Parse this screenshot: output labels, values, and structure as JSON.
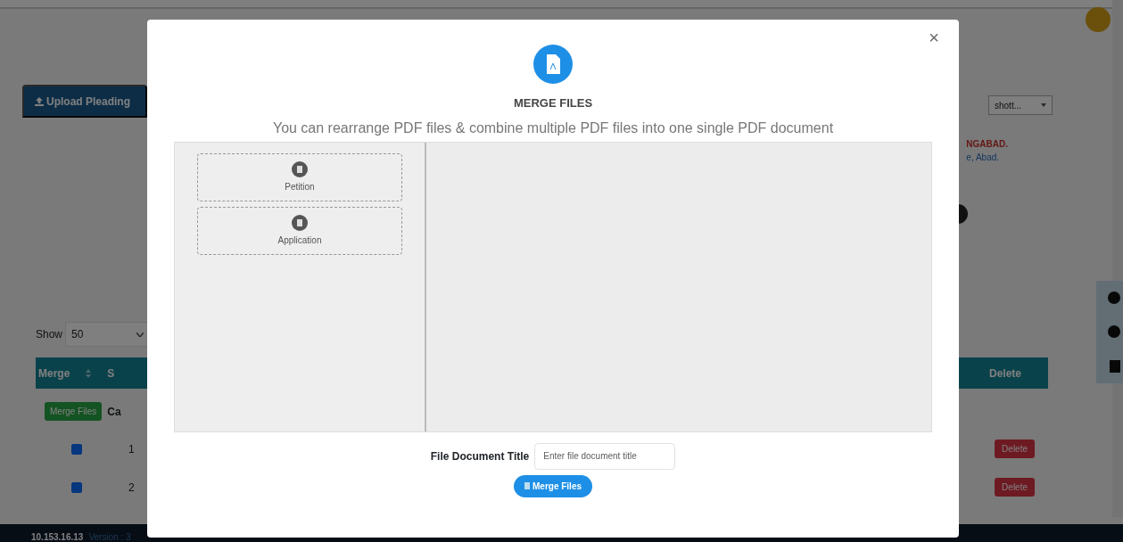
{
  "background": {
    "tab": "Upload Pleading",
    "select_value": "shott...",
    "notice_lines": [
      {
        "text": "NGABAD.",
        "kind": "title"
      },
      {
        "text": "e, Abad.",
        "kind": "address"
      }
    ],
    "show_label": "Show",
    "page_size": "50",
    "table": {
      "columns": [
        "Merge",
        "S",
        "Delete"
      ],
      "merge_button": "Merge Files",
      "row_text": "Ca",
      "rows": [
        {
          "sr": "1",
          "checked": true,
          "delete": "Delete"
        },
        {
          "sr": "2",
          "checked": true,
          "delete": "Delete"
        }
      ]
    },
    "footer": {
      "ip": "10.153.16.13",
      "version": "Version : 3"
    }
  },
  "modal": {
    "close": "×",
    "title": "MERGE FILES",
    "subtitle": "You can rearrange PDF files & combine multiple PDF files into one single PDF document",
    "files": [
      {
        "name": "Petition"
      },
      {
        "name": "Application"
      }
    ],
    "title_field": {
      "label": "File Document Title",
      "placeholder": "Enter file document title"
    },
    "submit": "Merge Files"
  }
}
